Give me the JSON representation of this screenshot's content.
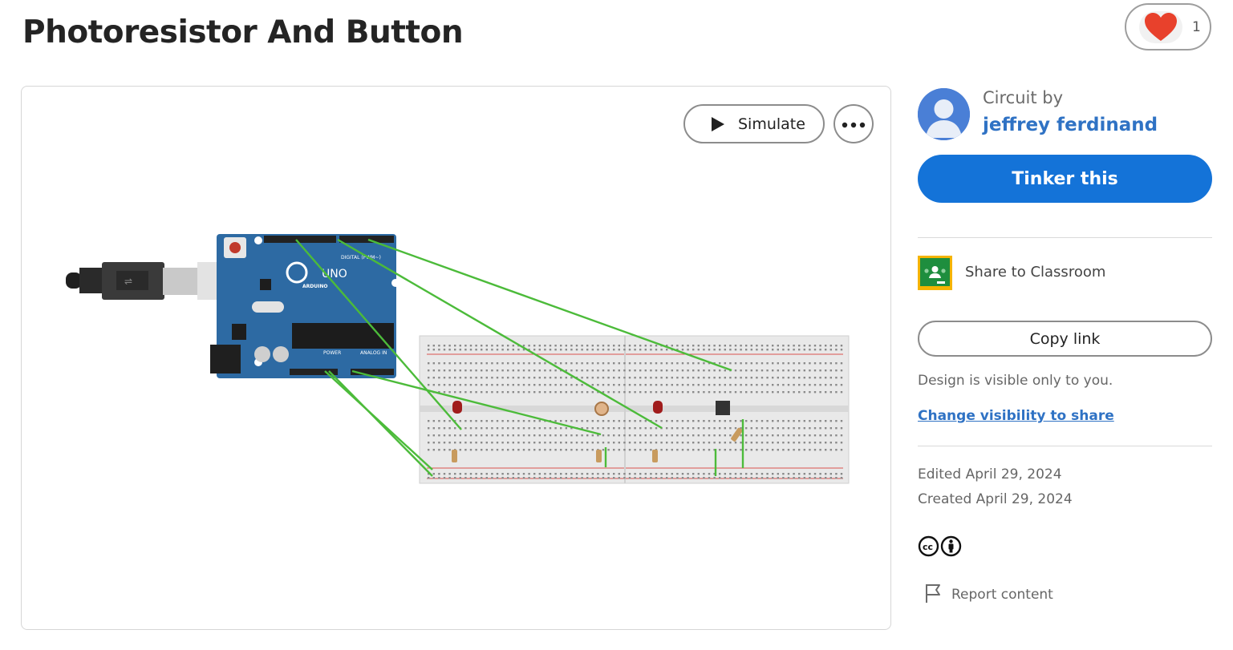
{
  "project": {
    "title": "Photoresistor And Button",
    "likes": "1"
  },
  "viewer": {
    "simulate_label": "Simulate",
    "board_labels": {
      "brand": "ARDUINO",
      "model": "UNO",
      "digital": "DIGITAL (PWM~)",
      "power": "POWER",
      "analog": "ANALOG IN"
    }
  },
  "sidebar": {
    "circuit_by_label": "Circuit by",
    "author_name": "jeffrey ferdinand",
    "tinker_label": "Tinker this",
    "classroom_label": "Share to Classroom",
    "copy_link_label": "Copy link",
    "visibility_note": "Design is visible only to you.",
    "change_visibility_label": "Change visibility to share",
    "edited": "Edited April 29, 2024",
    "created": "Created April 29, 2024",
    "report_label": "Report content"
  },
  "colors": {
    "accent": "#1473d8",
    "link": "#2f72c4",
    "heart": "#e8412c",
    "board": "#2d6aa3",
    "wire": "#4cbb3a",
    "classroom_green": "#1e8e3e",
    "classroom_yellow": "#f5b400"
  },
  "icons": {
    "like": "heart-icon",
    "simulate": "play-icon",
    "more": "more-dots-icon",
    "avatar": "user-avatar-icon",
    "classroom": "google-classroom-icon",
    "license": "creative-commons-by-icon",
    "report": "flag-icon"
  }
}
